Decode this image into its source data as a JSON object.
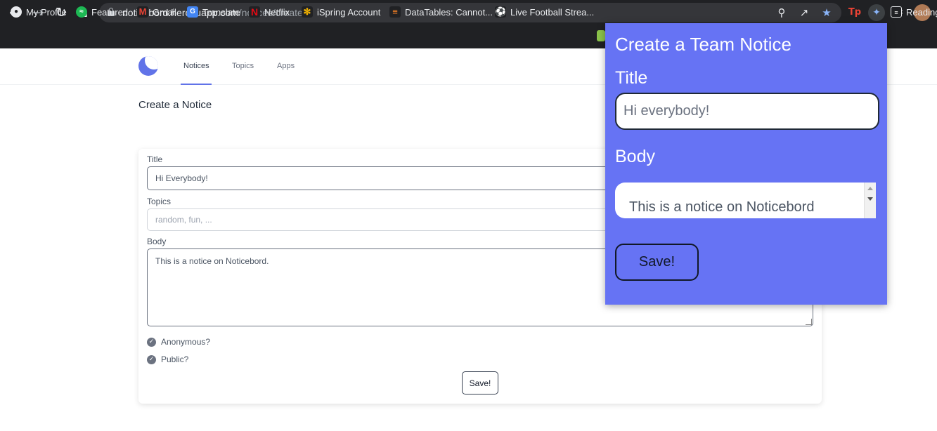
{
  "browser": {
    "url_host": "noticebord.herokuapp.com",
    "url_path": "/notices/create",
    "bookmarks": [
      {
        "label": "My Profile"
      },
      {
        "label": "Featured"
      },
      {
        "label": "Gmail"
      },
      {
        "label": "Translate"
      },
      {
        "label": "Netflix"
      },
      {
        "label": "iSpring Account"
      },
      {
        "label": "DataTables: Cannot..."
      },
      {
        "label": "Live Football Strea..."
      },
      {
        "label": "Reading"
      }
    ],
    "accent": "#8ab4f8"
  },
  "app": {
    "nav": [
      {
        "label": "Notices"
      },
      {
        "label": "Topics"
      },
      {
        "label": "Apps"
      }
    ],
    "page_title": "Create a Notice",
    "form": {
      "title_label": "Title",
      "title_value": "Hi Everybody!",
      "topics_label": "Topics",
      "topics_placeholder": "random, fun, ...",
      "body_label": "Body",
      "body_value": "This is a notice on Noticebord.",
      "anonymous_label": "Anonymous?",
      "public_label": "Public?",
      "save_label": "Save!"
    },
    "accent": "#6173e8"
  },
  "popup": {
    "heading": "Create a Team Notice",
    "title_label": "Title",
    "title_value": "Hi everybody!",
    "body_label": "Body",
    "body_value": "This is a notice on Noticebord",
    "save_label": "Save!",
    "background": "#6673f4"
  }
}
